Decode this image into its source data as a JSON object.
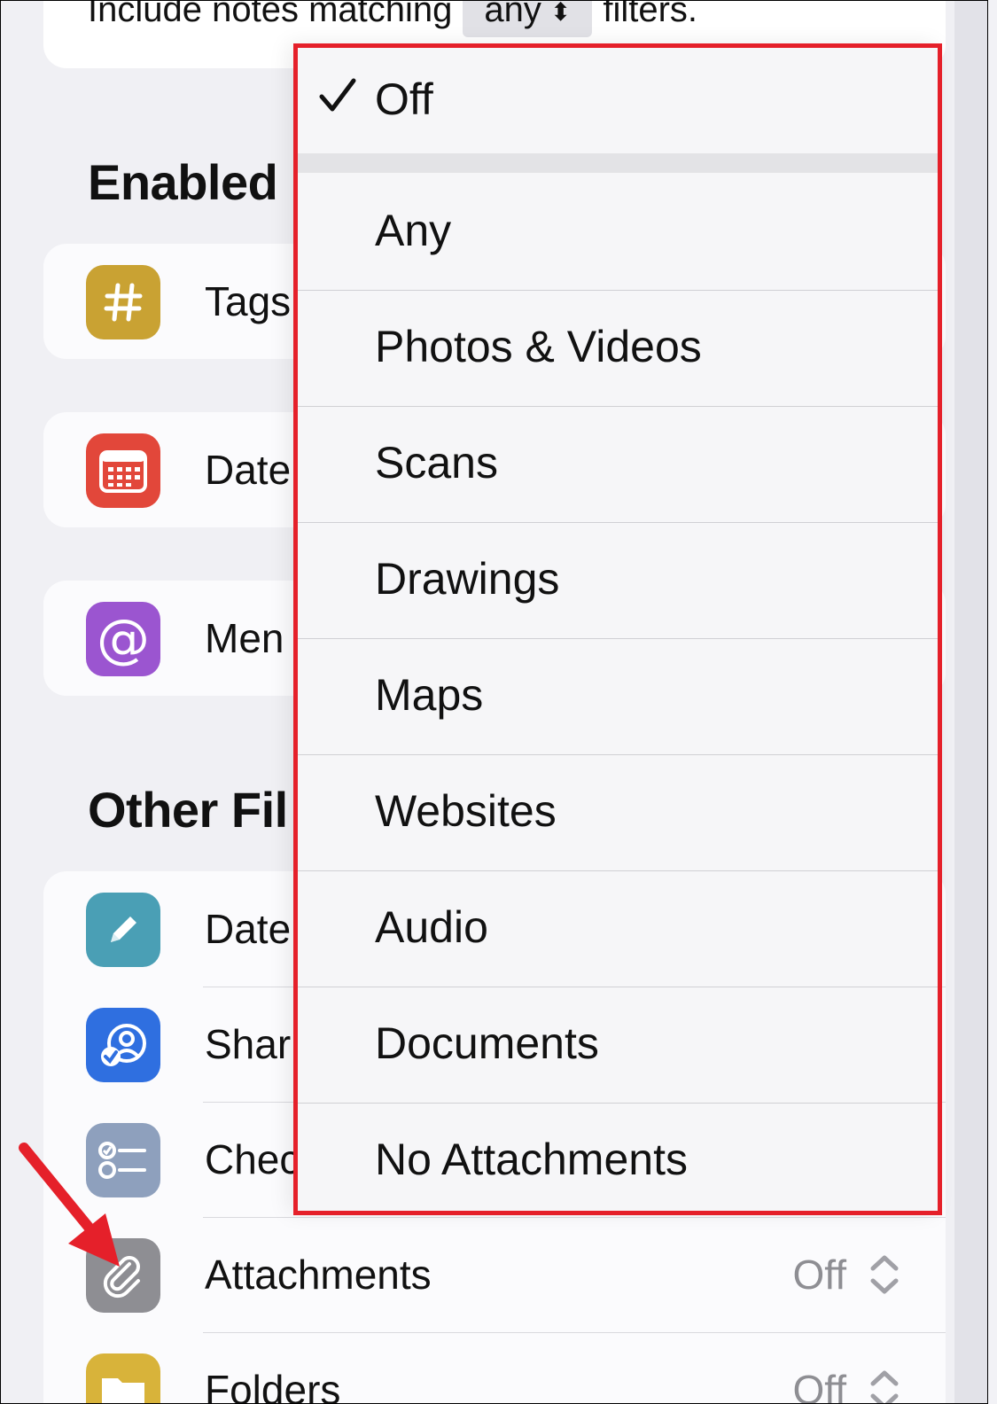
{
  "filter_line": {
    "prefix": "Include notes matching",
    "match_value": "any",
    "suffix": "filters."
  },
  "sections": {
    "enabled_title": "Enabled",
    "other_title": "Other Fil"
  },
  "enabled_filters": [
    {
      "label": "Tags",
      "icon": "hashtag-icon",
      "color": "#c9a233"
    },
    {
      "label": "Date",
      "icon": "calendar-icon",
      "color": "#e2473a"
    },
    {
      "label": "Men",
      "icon": "at-sign-icon",
      "color": "#9b55d0"
    }
  ],
  "other_filters": [
    {
      "label": "Date",
      "icon": "pencil-icon",
      "color": "#4a9fb5"
    },
    {
      "label": "Shar",
      "icon": "shared-person-icon",
      "color": "#2f6fe0"
    },
    {
      "label": "Chec",
      "icon": "checklist-icon",
      "color": "#8ea0bd"
    },
    {
      "label": "Attachments",
      "icon": "paperclip-icon",
      "color": "#8e8e93",
      "value": "Off"
    },
    {
      "label": "Folders",
      "icon": "folder-icon",
      "color": "#d8b33a",
      "value": "Off"
    }
  ],
  "menu": {
    "selected": "Off",
    "items": [
      "Off",
      "Any",
      "Photos & Videos",
      "Scans",
      "Drawings",
      "Maps",
      "Websites",
      "Audio",
      "Documents",
      "No Attachments"
    ]
  },
  "colors": {
    "highlight_border": "#e5202a",
    "arrow": "#e5202a"
  }
}
